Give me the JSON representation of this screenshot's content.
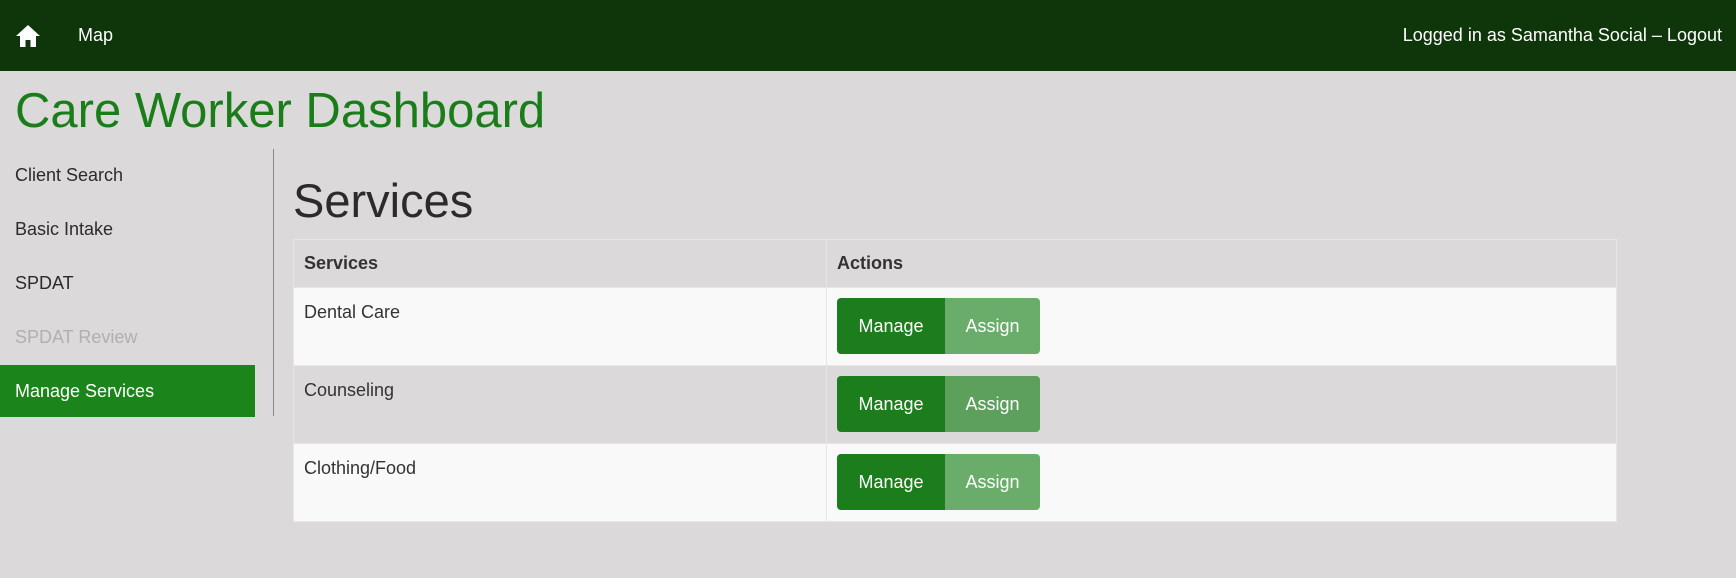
{
  "topbar": {
    "home_icon": "home-icon",
    "map_label": "Map",
    "login_status": "Logged in as Samantha Social – Logout"
  },
  "page_title": "Care Worker Dashboard",
  "sidebar": {
    "items": [
      {
        "label": "Client Search",
        "state": "normal"
      },
      {
        "label": "Basic Intake",
        "state": "normal"
      },
      {
        "label": "SPDAT",
        "state": "normal"
      },
      {
        "label": "SPDAT Review",
        "state": "disabled"
      },
      {
        "label": "Manage Services",
        "state": "active"
      }
    ]
  },
  "main": {
    "title": "Services",
    "table": {
      "headers": [
        "Services",
        "Actions"
      ],
      "rows": [
        {
          "name": "Dental Care",
          "manage_label": "Manage",
          "assign_label": "Assign"
        },
        {
          "name": "Counseling",
          "manage_label": "Manage",
          "assign_label": "Assign"
        },
        {
          "name": "Clothing/Food",
          "manage_label": "Manage",
          "assign_label": "Assign"
        }
      ]
    }
  },
  "colors": {
    "topbar": "#0f360b",
    "accent": "#1b851b",
    "assign_button": "#6aad6a",
    "background": "#dbd9da"
  }
}
